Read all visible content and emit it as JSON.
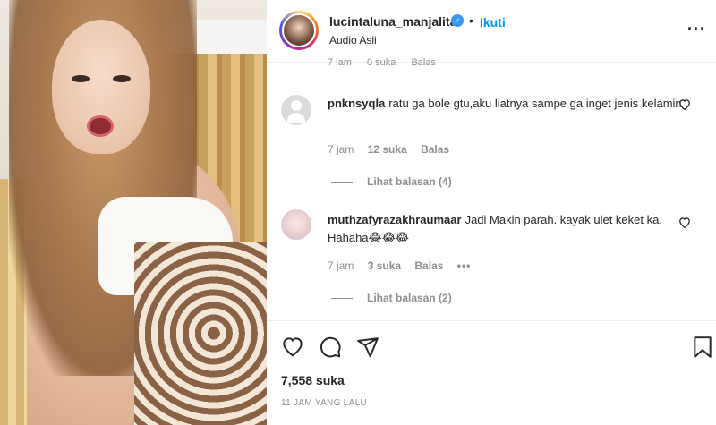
{
  "post": {
    "username": "lucintaluna_manjalita",
    "verified_mark": "✓",
    "separator": "•",
    "follow_label": "Ikuti",
    "audio_label": "Audio Asli",
    "more_label": "···"
  },
  "previous_comment_meta": {
    "time": "7 jam",
    "likes": "0 suka",
    "reply_label": "Balas"
  },
  "comments": [
    {
      "username": "pnknsyqla",
      "text": "ratu ga bole gtu,aku liatnya sampe ga inget jenis kelamin",
      "time": "7 jam",
      "likes": "12 suka",
      "reply_label": "Balas",
      "view_replies": "Lihat balasan (4)"
    },
    {
      "username": "muthzafyrazakhraumaar",
      "text": "Jadi Makin parah. kayak ulet keket ka. Hahaha😂😂😂",
      "time": "7 jam",
      "likes": "3 suka",
      "reply_label": "Balas",
      "more": "•••",
      "view_replies": "Lihat balasan (2)"
    }
  ],
  "footer": {
    "likes_count": "7,558 suka",
    "posted_time": "11 JAM YANG LALU"
  },
  "icons": {
    "like": "heart-icon",
    "comment": "comment-icon",
    "share": "paper-plane-icon",
    "save": "bookmark-icon",
    "comment_like": "heart-outline-icon",
    "more": "more-horizontal-icon"
  },
  "colors": {
    "accent": "#0095f6",
    "verified": "#3897f0",
    "text": "#262626",
    "muted": "#8e8e8e"
  }
}
